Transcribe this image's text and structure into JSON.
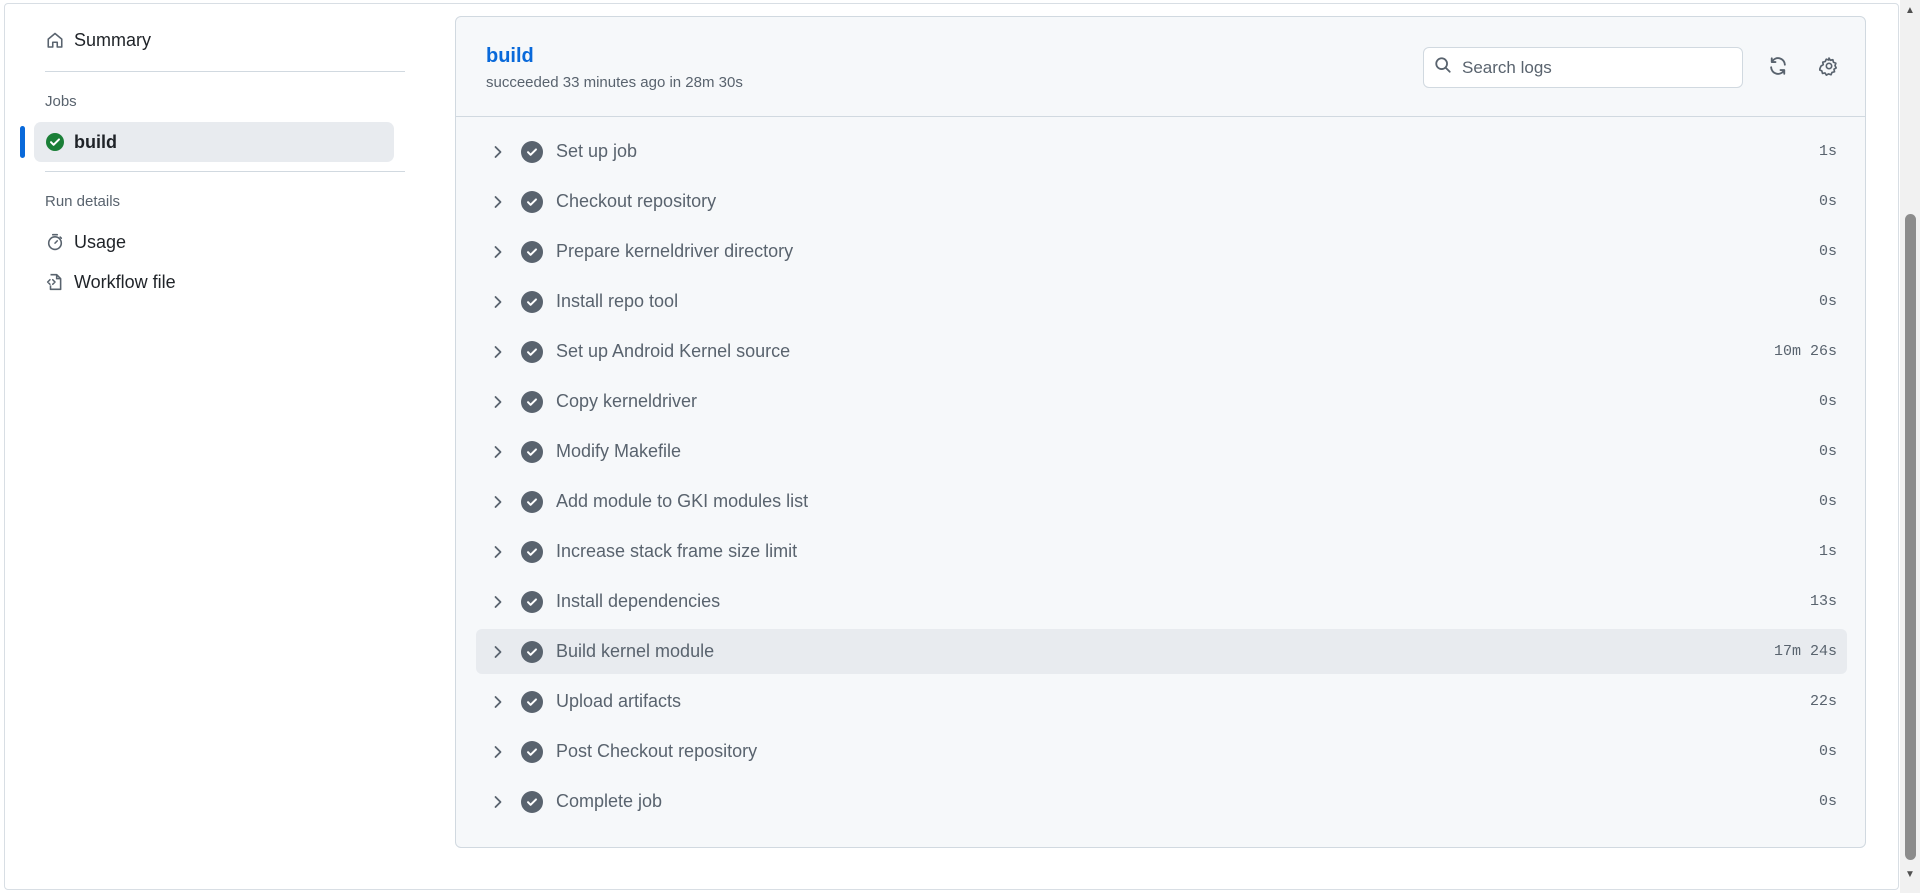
{
  "sidebar": {
    "summary_label": "Summary",
    "jobs_heading": "Jobs",
    "job_label": "build",
    "run_details_heading": "Run details",
    "usage_label": "Usage",
    "workflow_file_label": "Workflow file"
  },
  "header": {
    "title": "build",
    "subtitle": "succeeded 33 minutes ago in 28m 30s",
    "search_placeholder": "Search logs"
  },
  "steps": [
    {
      "name": "Set up job",
      "duration": "1s"
    },
    {
      "name": "Checkout repository",
      "duration": "0s"
    },
    {
      "name": "Prepare kerneldriver directory",
      "duration": "0s"
    },
    {
      "name": "Install repo tool",
      "duration": "0s"
    },
    {
      "name": "Set up Android Kernel source",
      "duration": "10m 26s"
    },
    {
      "name": "Copy kerneldriver",
      "duration": "0s"
    },
    {
      "name": "Modify Makefile",
      "duration": "0s"
    },
    {
      "name": "Add module to GKI modules list",
      "duration": "0s"
    },
    {
      "name": "Increase stack frame size limit",
      "duration": "1s"
    },
    {
      "name": "Install dependencies",
      "duration": "13s"
    },
    {
      "name": "Build kernel module",
      "duration": "17m 24s"
    },
    {
      "name": "Upload artifacts",
      "duration": "22s"
    },
    {
      "name": "Post Checkout repository",
      "duration": "0s"
    },
    {
      "name": "Complete job",
      "duration": "0s"
    }
  ],
  "colors": {
    "accent": "#0969da",
    "success": "#1a7f37",
    "muted": "#59636e"
  }
}
